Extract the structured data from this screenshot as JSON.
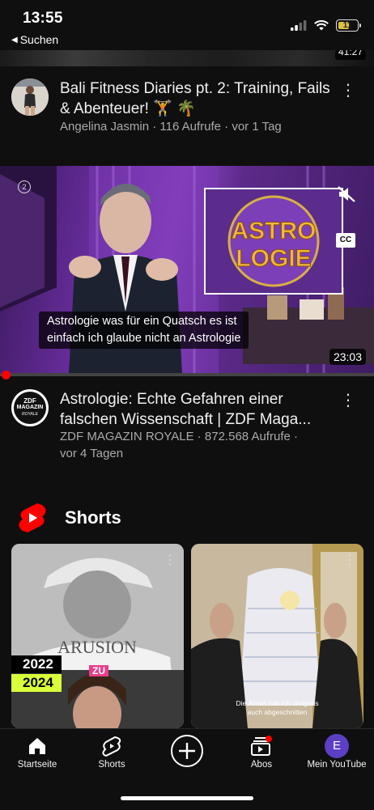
{
  "status_bar": {
    "time": "13:55",
    "back_label": "Suchen",
    "battery": "11"
  },
  "prev_video": {
    "duration": "41:27"
  },
  "video1": {
    "title": "Bali Fitness Diaries pt. 2: Training, Fails & Abenteuer! 🏋️ 🌴",
    "meta": "Angelina Jasmin · 116 Aufrufe · vor 1 Tag"
  },
  "player": {
    "subtitle_line1": "Astrologie was für ein Quatsch es ist",
    "subtitle_line2": "einfach ich glaube nicht an Astrologie",
    "duration": "23:03",
    "logo_line1": "ASTRO",
    "logo_line2": "LOGIE",
    "cc_label": "CC",
    "progress_fraction": 0.01
  },
  "video2": {
    "title_line1": "Astrologie: Echte Gefahren einer",
    "title_line2": "falschen Wissenschaft | ZDF Maga...",
    "meta_line1": "ZDF MAGAZIN ROYALE · 872.568 Aufrufe ·",
    "meta_line2": "vor 4 Tagen",
    "channel_logo_line1": "ZDF",
    "channel_logo_line2": "MAGAZIN",
    "channel_logo_line3": "ROYALE"
  },
  "shorts": {
    "label": "Shorts",
    "card1": {
      "year_top": "2022",
      "year_bottom": "2024",
      "zu": "ZU"
    },
    "card2": {
      "caption_line1": "Die Ärmel hab ich übrigens",
      "caption_line2": "auch abgeschnitten"
    }
  },
  "nav": {
    "home": "Startseite",
    "shorts": "Shorts",
    "subs": "Abos",
    "you": "Mein YouTube",
    "avatar_letter": "E"
  },
  "colors": {
    "background": "#0f0f0f",
    "youtube_red": "#ff0000",
    "avatar_purple": "#5b3fc4"
  }
}
